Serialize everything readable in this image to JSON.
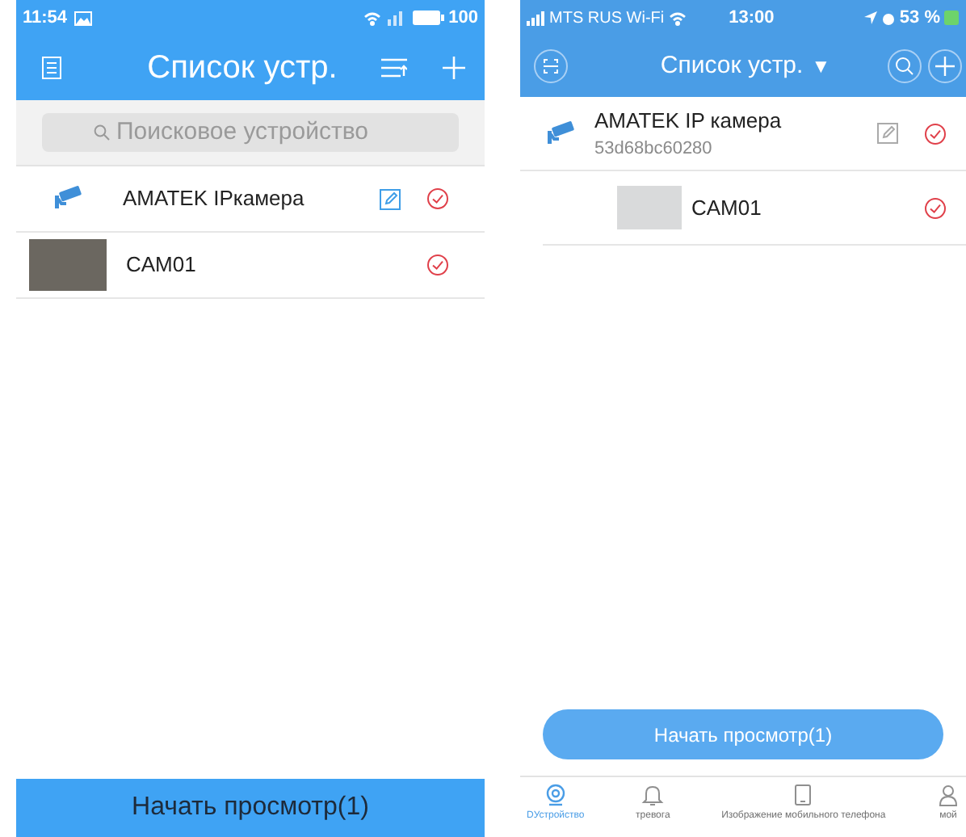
{
  "left_screen": {
    "kind": "android",
    "status_bar": {
      "time": "11:54",
      "battery": "100"
    },
    "header": {
      "title": "Список устр."
    },
    "search": {
      "placeholder": "Поисковое устройство"
    },
    "devices": [
      {
        "kind": "camera",
        "name": "AMATEK IPкамера",
        "editable": true,
        "selected": true
      },
      {
        "kind": "channel",
        "name": "CAM01",
        "editable": false,
        "selected": true
      }
    ],
    "start_button": "Начать просмотр(1)"
  },
  "right_screen": {
    "kind": "ios",
    "status_bar": {
      "carrier": "MTS RUS Wi-Fi",
      "time": "13:00",
      "battery": "53 %"
    },
    "header": {
      "title": "Список устр.",
      "caret": "▼"
    },
    "devices": [
      {
        "kind": "camera",
        "name": "AMATEK IP камера",
        "serial": "53d68bc60280",
        "editable": true,
        "selected": true
      },
      {
        "kind": "channel",
        "name": "CAM01",
        "editable": false,
        "selected": true
      }
    ],
    "start_button": "Начать просмотр(1)",
    "tabs": [
      {
        "label": "DУстройство",
        "selected": true
      },
      {
        "label": "тревога",
        "selected": false
      },
      {
        "label": "Изображение мобильного телефона",
        "selected": false
      },
      {
        "label": "мой",
        "selected": false
      }
    ]
  }
}
